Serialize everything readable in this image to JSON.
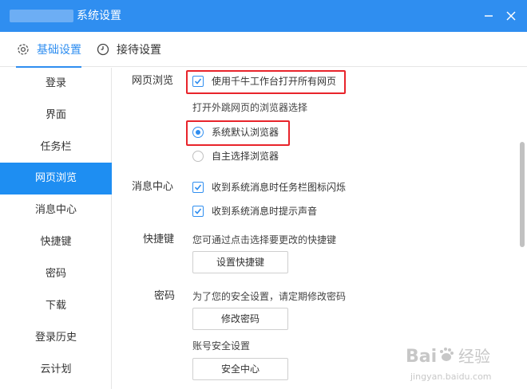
{
  "window": {
    "title": "系统设置"
  },
  "tabs": [
    {
      "label": "基础设置",
      "icon": "gear-icon"
    },
    {
      "label": "接待设置",
      "icon": "clock-icon"
    }
  ],
  "sidebar": {
    "items": [
      {
        "label": "登录"
      },
      {
        "label": "界面"
      },
      {
        "label": "任务栏"
      },
      {
        "label": "网页浏览"
      },
      {
        "label": "消息中心"
      },
      {
        "label": "快捷键"
      },
      {
        "label": "密码"
      },
      {
        "label": "下载"
      },
      {
        "label": "登录历史"
      },
      {
        "label": "云计划"
      }
    ],
    "active_index": 3
  },
  "web_browsing": {
    "section_label": "网页浏览",
    "open_all_label": "使用千牛工作台打开所有网页",
    "open_all_checked": true,
    "browser_choice_label": "打开外跳网页的浏览器选择",
    "option_default": "系统默认浏览器",
    "option_custom": "自主选择浏览器",
    "selected": "系统默认浏览器"
  },
  "message_center": {
    "section_label": "消息中心",
    "flash_label": "收到系统消息时任务栏图标闪烁",
    "flash_checked": true,
    "sound_label": "收到系统消息时提示声音",
    "sound_checked": true
  },
  "shortcuts": {
    "section_label": "快捷键",
    "desc": "您可通过点击选择要更改的快捷键",
    "button": "设置快捷键"
  },
  "password": {
    "section_label": "密码",
    "desc": "为了您的安全设置，请定期修改密码",
    "button": "修改密码",
    "account_label": "账号安全设置",
    "security_button": "安全中心"
  },
  "watermark": {
    "main": "Bai",
    "suffix": "经验",
    "url": "jingyan.baidu.com"
  },
  "colors": {
    "accent": "#2f8ef0",
    "sidebar_active": "#1e8ef2",
    "highlight_box": "#e8242b"
  }
}
